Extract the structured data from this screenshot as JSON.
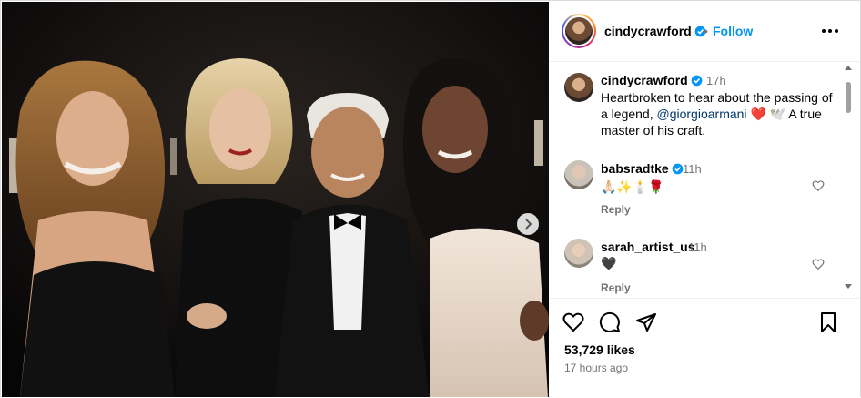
{
  "post": {
    "author": "cindycrawford",
    "follow_label": "Follow",
    "separator": "•",
    "photo_description_icon": "group-photo"
  },
  "caption": {
    "user": "cindycrawford",
    "time": "17h",
    "text_before": "Heartbroken to hear about the passing of a legend,",
    "mention": "@giorgioarmani",
    "text_after": "❤️ 🕊️ A true master of his craft."
  },
  "comments": [
    {
      "user": "babsradtke",
      "verified": true,
      "time": "11h",
      "text": "🙏🏻✨🕯️🌹",
      "reply_label": "Reply"
    },
    {
      "user": "sarah_artist_us",
      "verified": false,
      "time": "11h",
      "text": "🖤",
      "reply_label": "Reply"
    }
  ],
  "stats": {
    "likes": "53,729 likes",
    "posted": "17 hours ago"
  },
  "colors": {
    "link": "#0095f6",
    "verified": "#0095f6",
    "mention": "#00376b",
    "muted": "#737373"
  }
}
